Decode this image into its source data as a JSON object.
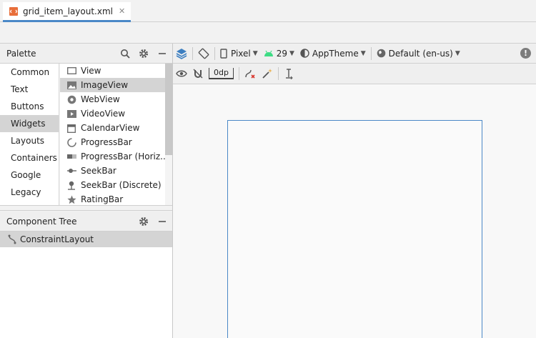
{
  "tab": {
    "label": "grid_item_layout.xml",
    "close": "✕"
  },
  "palette": {
    "title": "Palette",
    "categories": [
      "Common",
      "Text",
      "Buttons",
      "Widgets",
      "Layouts",
      "Containers",
      "Google",
      "Legacy"
    ],
    "selected_category": "Widgets",
    "widgets": [
      "View",
      "ImageView",
      "WebView",
      "VideoView",
      "CalendarView",
      "ProgressBar",
      "ProgressBar (Horiz...",
      "SeekBar",
      "SeekBar (Discrete)",
      "RatingBar"
    ],
    "selected_widget": "ImageView"
  },
  "component_tree": {
    "title": "Component Tree",
    "root": "ConstraintLayout"
  },
  "toolbar": {
    "device": "Pixel",
    "api": "29",
    "theme": "AppTheme",
    "locale": "Default (en-us)",
    "margin": "0dp",
    "warning": "!"
  },
  "colors": {
    "accent": "#4a88c7",
    "selection": "#d4d4d4",
    "android_green": "#3ddc84"
  }
}
